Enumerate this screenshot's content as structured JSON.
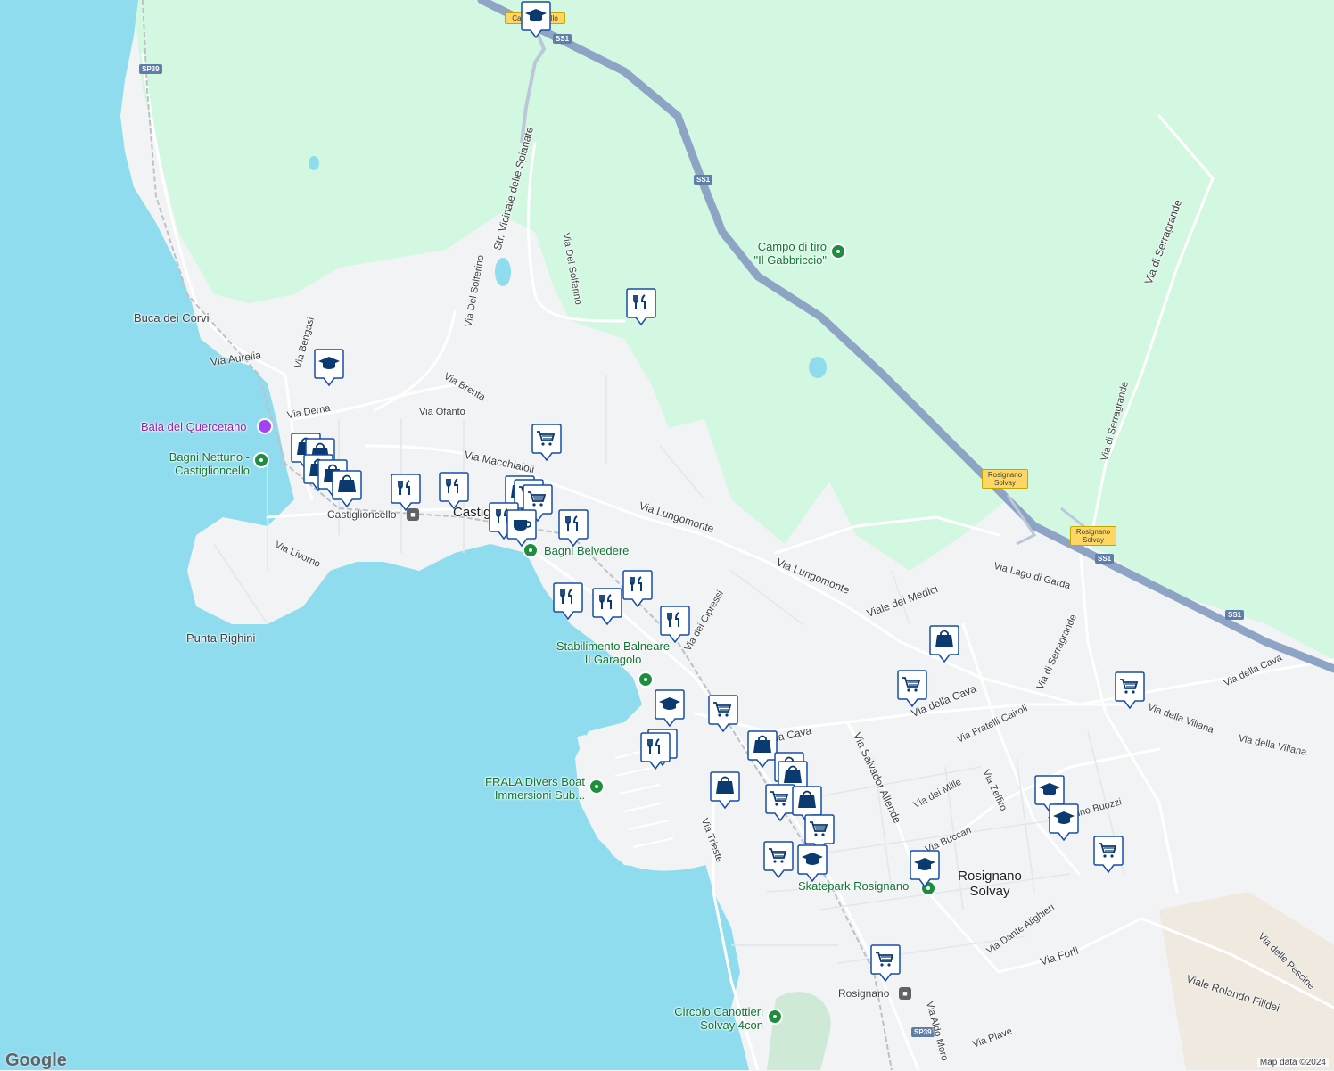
{
  "attribution": {
    "google": "Google",
    "map_data": "Map data ©2024"
  },
  "streets": [
    {
      "name": "Str. Vicinale delle Spianate"
    },
    {
      "name": "Via Del Solferino"
    },
    {
      "name": "Via Del Solferino"
    },
    {
      "name": "Via Bengasi"
    },
    {
      "name": "Via Aurelia"
    },
    {
      "name": "Via Brenta"
    },
    {
      "name": "Via Derna"
    },
    {
      "name": "Via Ofanto"
    },
    {
      "name": "Via Macchiaioli"
    },
    {
      "name": "Via Lungomonte"
    },
    {
      "name": "Via Lungomonte"
    },
    {
      "name": "Via Livorno"
    },
    {
      "name": "Via dei Cipressi"
    },
    {
      "name": "Viale dei Medici"
    },
    {
      "name": "Via Lago di Garda"
    },
    {
      "name": "Via di Serragrande"
    },
    {
      "name": "Via di Serragrande"
    },
    {
      "name": "Via di Serragrande"
    },
    {
      "name": "Via della Cava"
    },
    {
      "name": "Via della Cava"
    },
    {
      "name": "Via Cava"
    },
    {
      "name": "Via della Villana"
    },
    {
      "name": "Via della Villana"
    },
    {
      "name": "Via Fratelli Cairoli"
    },
    {
      "name": "Via Salvador Allende"
    },
    {
      "name": "Via dei Mille"
    },
    {
      "name": "Via Zeffiro"
    },
    {
      "name": "Via Bruno Buozzi"
    },
    {
      "name": "Via Buccari"
    },
    {
      "name": "Via Trieste"
    },
    {
      "name": "Via Dante Alighieri"
    },
    {
      "name": "Via Forlì"
    },
    {
      "name": "Viale Rolando Filidei"
    },
    {
      "name": "Via delle Pescine"
    },
    {
      "name": "Via Aldo Moro"
    },
    {
      "name": "Via Piave"
    }
  ],
  "road_shields": [
    {
      "ref": "SP39"
    },
    {
      "ref": "SS1"
    },
    {
      "ref": "SS1"
    },
    {
      "ref": "SS1"
    },
    {
      "ref": "SS1"
    },
    {
      "ref": "SP39"
    }
  ],
  "exit_labels": [
    {
      "text": "Castiglioncello"
    },
    {
      "text": "Rosignano Solvay"
    },
    {
      "text": "Rosignano Solvay"
    }
  ],
  "towns": [
    {
      "name": "Rosignano Solvay"
    },
    {
      "name": "Castiglioncello"
    }
  ],
  "stations": [
    {
      "name": "Castiglioncello"
    },
    {
      "name": "Rosignano"
    }
  ],
  "places": [
    {
      "name": "Buca dei Corvi",
      "kind": "area"
    },
    {
      "name": "Punta Righini",
      "kind": "area"
    },
    {
      "name": "Baia del Quercetano",
      "kind": "attraction"
    },
    {
      "name": "Bagni Nettuno - Castiglioncello",
      "kind": "green"
    },
    {
      "name": "Bagni Belvedere",
      "kind": "green"
    },
    {
      "name": "Campo di tiro \"Il Gabbriccio\"",
      "kind": "green"
    },
    {
      "name": "Stabilimento Balneare Il Garagolo",
      "kind": "green"
    },
    {
      "name": "FRALA Divers Boat Immersioni Sub...",
      "kind": "green"
    },
    {
      "name": "Skatepark Rosignano",
      "kind": "green"
    },
    {
      "name": "Circolo Canottieri Solvay 4con",
      "kind": "green"
    }
  ],
  "markers": [
    {
      "type": "school"
    },
    {
      "type": "restaurant"
    },
    {
      "type": "school"
    },
    {
      "type": "grocery"
    },
    {
      "type": "shopping"
    },
    {
      "type": "shopping"
    },
    {
      "type": "shopping"
    },
    {
      "type": "shopping"
    },
    {
      "type": "shopping"
    },
    {
      "type": "restaurant"
    },
    {
      "type": "restaurant"
    },
    {
      "type": "shopping"
    },
    {
      "type": "grocery"
    },
    {
      "type": "grocery"
    },
    {
      "type": "restaurant"
    },
    {
      "type": "cafe"
    },
    {
      "type": "restaurant"
    },
    {
      "type": "restaurant"
    },
    {
      "type": "restaurant"
    },
    {
      "type": "restaurant"
    },
    {
      "type": "restaurant"
    },
    {
      "type": "school"
    },
    {
      "type": "grocery"
    },
    {
      "type": "restaurant"
    },
    {
      "type": "restaurant"
    },
    {
      "type": "shopping"
    },
    {
      "type": "shopping"
    },
    {
      "type": "shopping"
    },
    {
      "type": "grocery"
    },
    {
      "type": "shopping"
    },
    {
      "type": "grocery"
    },
    {
      "type": "grocery"
    },
    {
      "type": "school"
    },
    {
      "type": "school"
    },
    {
      "type": "shopping"
    },
    {
      "type": "grocery"
    },
    {
      "type": "grocery"
    },
    {
      "type": "school"
    },
    {
      "type": "school"
    },
    {
      "type": "grocery"
    },
    {
      "type": "grocery"
    }
  ],
  "colors": {
    "sea": "#8fdcee",
    "forest": "#d3f8e2",
    "urban": "#f1f3f4",
    "highway": "#8ea4c4",
    "marker": "#174ea6",
    "marker_icon": "#0b3a70",
    "green_poi": "#1e8e3e",
    "purple_poi": "#a142f4"
  }
}
